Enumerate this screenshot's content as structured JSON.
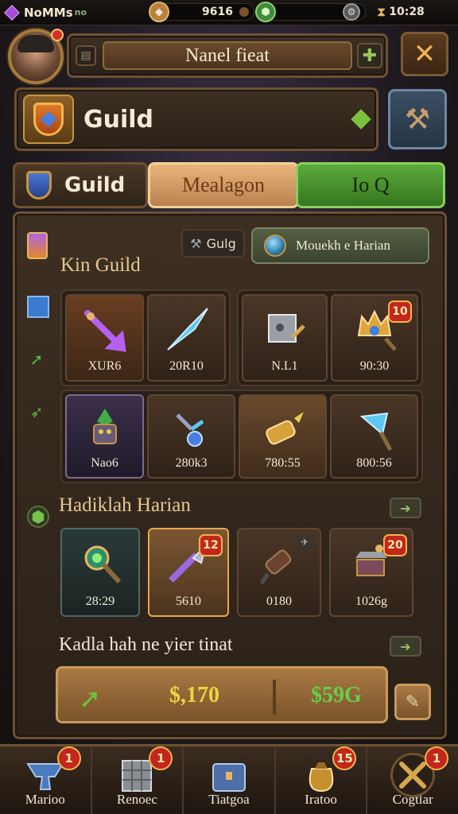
{
  "status_bar": {
    "app_name": "NoMMs",
    "app_suffix": "no",
    "resource1_value": "9616",
    "resource2_value": "",
    "time_text": "10:28"
  },
  "profile": {
    "name_bar_text": "Nanel fieat"
  },
  "guild_header": {
    "title": "Guild"
  },
  "tabs": [
    {
      "label": "Guild"
    },
    {
      "label": "Mealagon"
    },
    {
      "label": "Io Q"
    }
  ],
  "main": {
    "pill1_label": "Gulg",
    "pill2_label": "Mouekh e Harian",
    "section1_title": "Kin Guild",
    "grid1_row1_left": [
      {
        "label": "XUR6",
        "icon": "purple-arrow-icon"
      },
      {
        "label": "20R10",
        "icon": "blue-crystal-spear-icon"
      }
    ],
    "grid1_row1_right": [
      {
        "label": "N.L1",
        "icon": "steel-box-icon"
      },
      {
        "label": "90:30",
        "icon": "golden-helm-icon",
        "badge": "10"
      }
    ],
    "grid1_row2": [
      {
        "label": "Nao6",
        "icon": "goblin-knight-icon"
      },
      {
        "label": "280k3",
        "icon": "crystal-amulet-icon"
      },
      {
        "label": "780:55",
        "icon": "cannon-shell-icon"
      },
      {
        "label": "800:56",
        "icon": "blue-axe-icon"
      }
    ],
    "section2_title": "Hadiklah Harian",
    "grid2": [
      {
        "label": "28:29",
        "icon": "emerald-mace-icon"
      },
      {
        "label": "5610",
        "icon": "crystal-lance-icon",
        "badge": "12"
      },
      {
        "label": "0180",
        "icon": "dark-cannon-icon"
      },
      {
        "label": "1026g",
        "icon": "anvil-crate-icon",
        "badge": "20"
      }
    ],
    "section3_title": "Kadla hah ne yier tinat",
    "gold_value": "$,170",
    "green_value": "$59G"
  },
  "bottom_nav": [
    {
      "label": "Marioo",
      "badge": "1",
      "icon": "blue-anvil-icon"
    },
    {
      "label": "Renoec",
      "badge": "1",
      "icon": "iron-crate-icon"
    },
    {
      "label": "Tiatgoa",
      "badge": "",
      "icon": "blue-chest-icon"
    },
    {
      "label": "Iratoo",
      "badge": "15",
      "icon": "treasure-sack-icon"
    },
    {
      "label": "Cogtlar",
      "badge": "1",
      "icon": "crossed-tools-icon"
    }
  ],
  "colors": {
    "accent_gold": "#c7953f",
    "tab_active": "#e9b57b",
    "tab_green": "#5cab3c",
    "badge_red": "#c2261d",
    "value_gold": "#f0d43e",
    "value_green": "#67cf4a"
  }
}
